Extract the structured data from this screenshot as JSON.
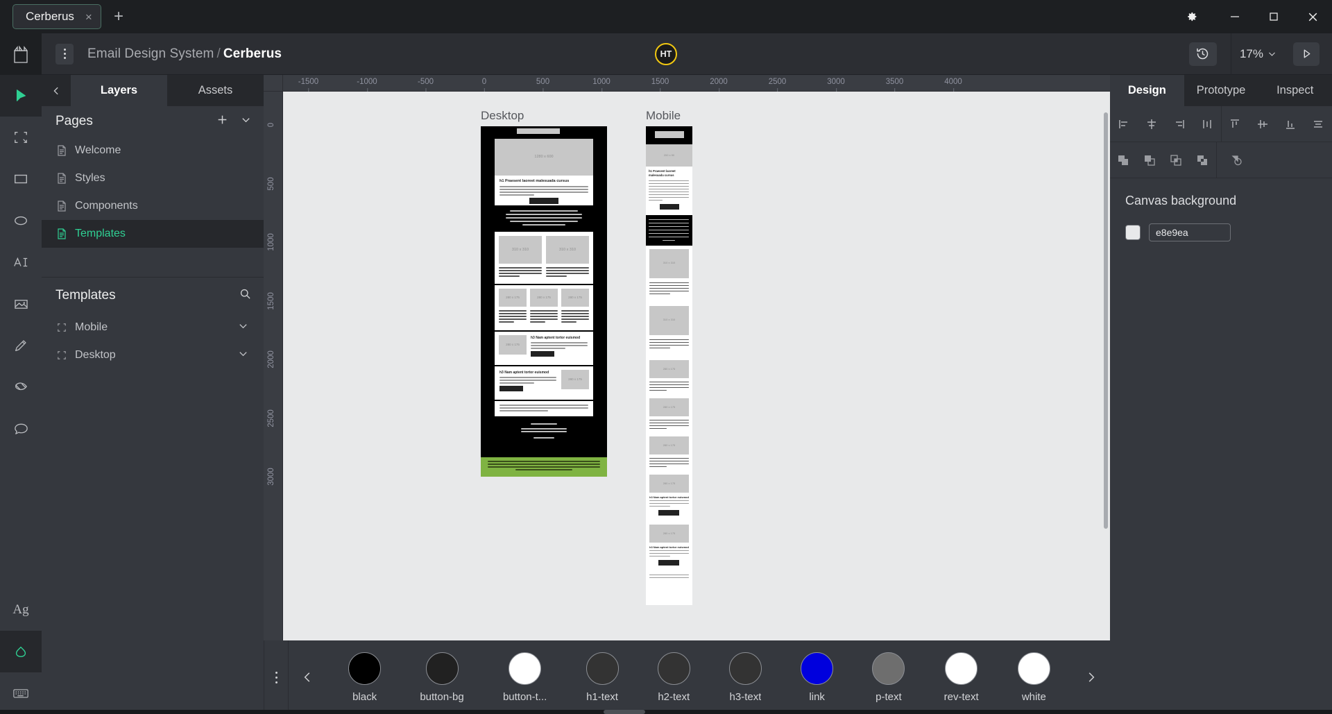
{
  "window": {
    "tab_title": "Cerberus",
    "close_label": "×",
    "new_tab_label": "+",
    "icons": {
      "gear": "gear-icon",
      "minimize": "minimize-icon",
      "maximize": "maximize-icon",
      "close": "close-icon"
    }
  },
  "header": {
    "project": "Email Design System",
    "separator": "/",
    "file": "Cerberus",
    "avatar_initials": "HT",
    "zoom_level": "17%",
    "history_icon": "history-icon",
    "present_icon": "play-icon",
    "menu_icon": "kebab-menu-icon"
  },
  "toolbar": {
    "tools": [
      {
        "name": "move-tool",
        "icon": "cursor-icon",
        "active": true
      },
      {
        "name": "frame-tool",
        "icon": "frame-icon",
        "active": false
      },
      {
        "name": "rectangle-tool",
        "icon": "rectangle-icon",
        "active": false
      },
      {
        "name": "ellipse-tool",
        "icon": "ellipse-icon",
        "active": false
      },
      {
        "name": "text-tool",
        "icon": "text-icon",
        "active": false
      },
      {
        "name": "image-tool",
        "icon": "image-icon",
        "active": false
      },
      {
        "name": "pencil-tool",
        "icon": "pencil-icon",
        "active": false
      },
      {
        "name": "pen-tool",
        "icon": "pen-icon",
        "active": false
      },
      {
        "name": "comment-tool",
        "icon": "comment-icon",
        "active": false
      }
    ],
    "bottom_tools": [
      {
        "name": "font-tool",
        "icon": "Ag",
        "active": false
      },
      {
        "name": "theme-tool",
        "icon": "droplet-icon",
        "active": true
      },
      {
        "name": "keyboard-tool",
        "icon": "keyboard-icon",
        "active": false
      }
    ]
  },
  "left_panel": {
    "tabs": [
      {
        "label": "Layers",
        "active": true
      },
      {
        "label": "Assets",
        "active": false
      }
    ],
    "back_icon": "chevron-left-icon",
    "pages": {
      "title": "Pages",
      "add_icon": "plus-icon",
      "collapse_icon": "chevron-down-icon",
      "items": [
        {
          "label": "Welcome",
          "icon": "page-icon",
          "selected": false
        },
        {
          "label": "Styles",
          "icon": "page-icon",
          "selected": false
        },
        {
          "label": "Components",
          "icon": "page-icon",
          "selected": false
        },
        {
          "label": "Templates",
          "icon": "page-icon",
          "selected": true
        }
      ]
    },
    "layers": {
      "title": "Templates",
      "search_icon": "search-icon",
      "items": [
        {
          "label": "Mobile",
          "icon": "frame-icon",
          "chevron": "chevron-down-icon"
        },
        {
          "label": "Desktop",
          "icon": "frame-icon",
          "chevron": "chevron-down-icon"
        }
      ]
    }
  },
  "right_panel": {
    "tabs": [
      {
        "label": "Design",
        "active": true
      },
      {
        "label": "Prototype",
        "active": false
      },
      {
        "label": "Inspect",
        "active": false
      }
    ],
    "align_icons": [
      "align-left-icon",
      "align-horizontal-center-icon",
      "align-right-icon",
      "distribute-horizontal-icon",
      "align-top-icon",
      "align-vertical-center-icon",
      "align-bottom-icon",
      "distribute-vertical-icon"
    ],
    "boolean_icons": [
      "union-icon",
      "subtract-icon",
      "intersect-icon",
      "exclude-icon",
      "flatten-icon"
    ],
    "canvas_background": {
      "label": "Canvas background",
      "hex": "e8e9ea",
      "swatch_color": "#e8e9ea"
    }
  },
  "canvas": {
    "ruler_h": [
      "-1500",
      "-1000",
      "-500",
      "0",
      "500",
      "1000",
      "1500",
      "2000",
      "2500",
      "3000",
      "3500",
      "4000"
    ],
    "ruler_v": [
      "0",
      "500",
      "1000",
      "1500",
      "2000",
      "2500",
      "3000"
    ],
    "frames": [
      {
        "label": "Desktop"
      },
      {
        "label": "Mobile"
      }
    ],
    "email_mock": {
      "preheader_placeholder": "200 x 50",
      "hero_placeholder": "1280 x 600",
      "h1": "h1 Praesent laoreet malesuada cursus",
      "primary_button": "Primary Button",
      "two_up_placeholder": "310 x 310",
      "three_up_placeholder": "280 x 175",
      "h3": "h3 Nam aptent tortor euismod",
      "secondary_button": "Primary Button",
      "footer_title": "EMAIL ADDRESS"
    }
  },
  "swatch_bar": {
    "prev_icon": "chevron-left-icon",
    "next_icon": "chevron-right-icon",
    "menu_icon": "kebab-menu-icon",
    "swatches": [
      {
        "name": "black",
        "color": "#000000"
      },
      {
        "name": "button-bg",
        "color": "#212121"
      },
      {
        "name": "button-t...",
        "color": "#ffffff"
      },
      {
        "name": "h1-text",
        "color": "#333333"
      },
      {
        "name": "h2-text",
        "color": "#333333"
      },
      {
        "name": "h3-text",
        "color": "#333333"
      },
      {
        "name": "link",
        "color": "#0000dd"
      },
      {
        "name": "p-text",
        "color": "#6e6e6e"
      },
      {
        "name": "rev-text",
        "color": "#ffffff"
      },
      {
        "name": "white",
        "color": "#ffffff"
      }
    ]
  }
}
